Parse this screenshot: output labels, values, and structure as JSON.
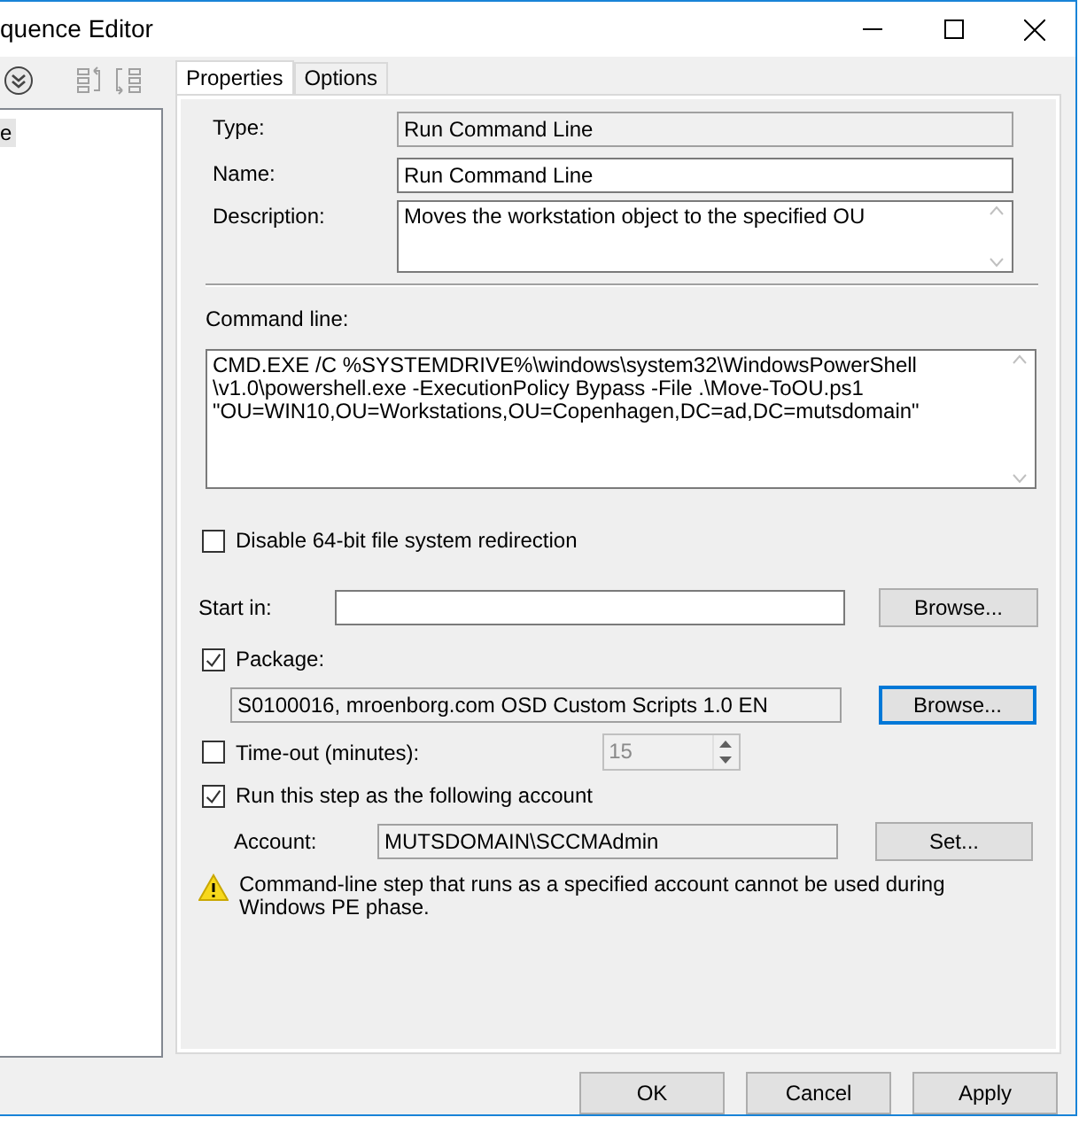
{
  "window": {
    "title": "quence Editor"
  },
  "toolbar": {
    "buttons": [
      {
        "kind": "expand",
        "disabled": false
      },
      {
        "kind": "move-up",
        "disabled": true
      },
      {
        "kind": "move-down",
        "disabled": true
      }
    ]
  },
  "tree": {
    "items": [
      {
        "label": "e",
        "selected": true
      }
    ]
  },
  "tabs": [
    {
      "label": "Properties",
      "selected": true
    },
    {
      "label": "Options",
      "selected": false
    }
  ],
  "properties": {
    "type": {
      "label": "Type:",
      "value": "Run Command Line",
      "readonly": true
    },
    "name": {
      "label": "Name:",
      "value": "Run Command Line",
      "readonly": false
    },
    "description": {
      "label": "Description:",
      "value": "Moves the workstation object to the specified OU"
    },
    "command_line": {
      "label": "Command line:",
      "value": "CMD.EXE /C %SYSTEMDRIVE%\\windows\\system32\\WindowsPowerShell\n\\v1.0\\powershell.exe -ExecutionPolicy Bypass -File .\\Move-ToOU.ps1\n\"OU=WIN10,OU=Workstations,OU=Copenhagen,DC=ad,DC=mutsdomain\""
    },
    "disable_redirection": {
      "label": "Disable 64-bit file system redirection",
      "checked": false
    },
    "start_in": {
      "label": "Start in:",
      "button": {
        "label": "Browse...",
        "focused": false
      }
    },
    "package": {
      "label": "Package:",
      "checked": true,
      "value": "S0100016, mroenborg.com OSD Custom Scripts 1.0 EN",
      "button": {
        "label": "Browse...",
        "focused": true
      }
    },
    "timeout": {
      "label": "Time-out (minutes):",
      "checked": false,
      "value": "15",
      "disabled": true
    },
    "run_as": {
      "label": "Run this step as the following account",
      "checked": true
    },
    "account": {
      "label": "Account:",
      "value": "MUTSDOMAIN\\SCCMAdmin",
      "button": {
        "label": "Set...",
        "focused": false
      }
    },
    "warning": "Command-line step that runs as a specified account cannot be used during Windows PE phase."
  },
  "buttons": [
    {
      "label": "OK"
    },
    {
      "label": "Cancel"
    },
    {
      "label": "Apply"
    }
  ]
}
